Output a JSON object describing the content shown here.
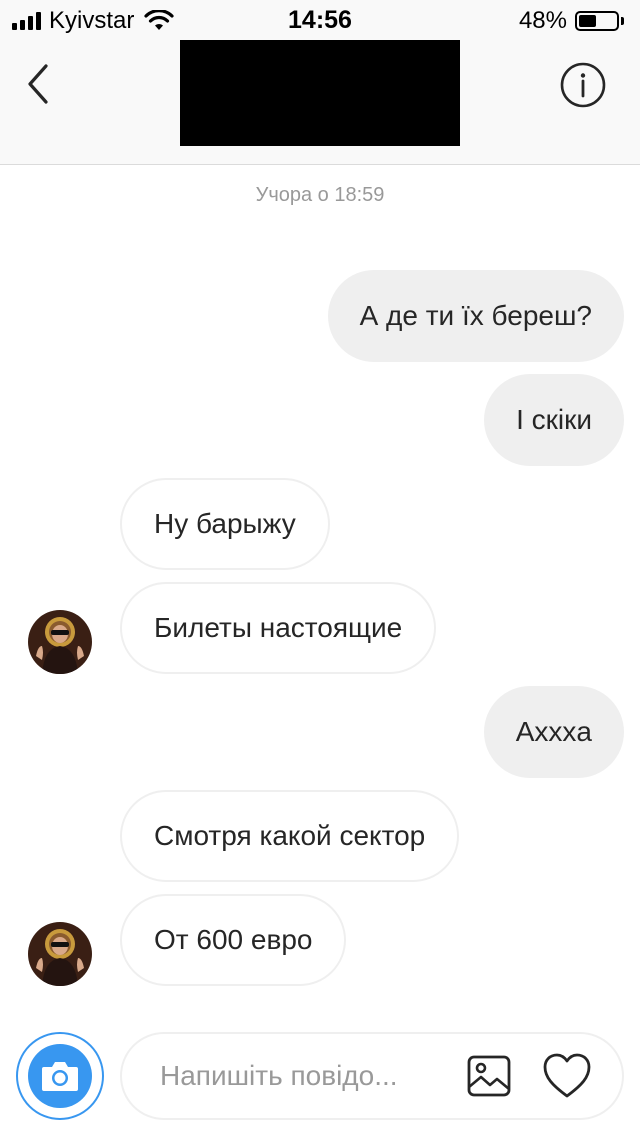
{
  "status_bar": {
    "carrier": "Kyivstar",
    "time": "14:56",
    "battery_percent": "48%",
    "battery_level": 0.48
  },
  "header": {
    "back_icon": "chevron-left-icon",
    "info_icon": "info-icon",
    "title_redacted": true
  },
  "conversation": {
    "timestamp": "Учора о 18:59",
    "messages": [
      {
        "direction": "outgoing",
        "text": "А де ти їх береш?"
      },
      {
        "direction": "outgoing",
        "text": "І скіки"
      },
      {
        "direction": "incoming",
        "text": "Ну барыжу"
      },
      {
        "direction": "incoming",
        "text": "Билеты настоящие",
        "avatar": true
      },
      {
        "direction": "outgoing",
        "text": "Ахххa"
      },
      {
        "direction": "incoming",
        "text": "Смотря какой сектор"
      },
      {
        "direction": "incoming",
        "text": "От 600 евро",
        "avatar": true
      }
    ]
  },
  "composer": {
    "placeholder": "Напишіть повідо...",
    "camera_icon": "camera-icon",
    "gallery_icon": "image-icon",
    "like_icon": "heart-icon",
    "accent_color": "#3897f0"
  }
}
